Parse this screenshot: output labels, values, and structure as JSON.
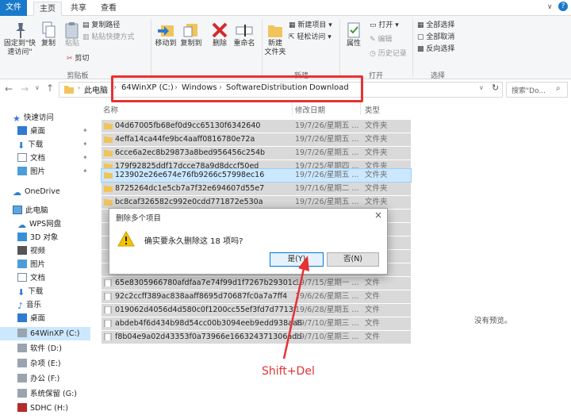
{
  "tabs": [
    "文件",
    "主页",
    "共享",
    "查看"
  ],
  "ribbon": {
    "pin": "固定到\"快\n速访问\"",
    "copy": "复制",
    "paste": "粘贴",
    "copy_path": "复制路径",
    "paste_shortcut": "粘贴快捷方式",
    "cut": "剪切",
    "move_to": "移动到",
    "copy_to": "复制到",
    "delete": "删除",
    "rename": "重命名",
    "new_folder": "新建\n文件夹",
    "new_item": "新建项目",
    "easy_access": "轻松访问",
    "properties": "属性",
    "open": "打开",
    "edit": "编辑",
    "history": "历史记录",
    "select_all": "全部选择",
    "select_none": "全部取消",
    "invert": "反向选择",
    "grp_clipboard": "剪贴板",
    "grp_new": "新建",
    "grp_open": "打开",
    "grp_select": "选择"
  },
  "address": {
    "crumbs": [
      "此电脑",
      "64WinXP  (C:)",
      "Windows",
      "SoftwareDistribution",
      "Download"
    ],
    "search_placeholder": "搜索\"Do..."
  },
  "nav": {
    "quick_access": "快速访问",
    "items": [
      "桌面",
      "下载",
      "文档",
      "图片"
    ],
    "onedrive": "OneDrive",
    "this_pc": "此电脑",
    "pc_items": [
      "WPS网盘",
      "3D 对象",
      "视频",
      "图片",
      "文档",
      "下载",
      "音乐",
      "桌面",
      "64WinXP  (C:)",
      "软件 (D:)",
      "杂项 (E:)",
      "办公 (F:)",
      "系统保留 (G:)",
      "SDHC (H:)"
    ]
  },
  "list": {
    "col_name": "名称",
    "col_date": "修改日期",
    "col_type": "类型",
    "rows": [
      {
        "name": "04d67005fb68ef0d9cc65130f6342640",
        "date": "19/7/26/星期五 ...",
        "type": "文件夹"
      },
      {
        "name": "4effa14ca44fe9bc4aaff0816780e72a",
        "date": "19/7/26/星期五 ...",
        "type": "文件夹"
      },
      {
        "name": "6cce6a2ec8b29873a8bed956456c254b",
        "date": "19/7/26/星期五 ...",
        "type": "文件夹"
      },
      {
        "name": "179f92825ddf17dcce78a9d8dccf50ed",
        "date": "19/7/25/星期四 ...",
        "type": "文件夹"
      },
      {
        "name": "123902e26e674e76fb9266c57998ec16",
        "date": "19/7/26/星期五 ...",
        "type": "文件夹"
      },
      {
        "name": "8725264dc1e5cb7a7f32e694607d55e7",
        "date": "19/7/16/星期二 ...",
        "type": "文件夹"
      },
      {
        "name": "bc8caf326582c992e0cdd771872e530a",
        "date": "19/7/26/星期五 ...",
        "type": "文件夹"
      },
      {
        "name": "65e8305966780afdfaa7e74f99d1f7267b29301c",
        "date": "19/7/15/星期一 ...",
        "type": "文件"
      },
      {
        "name": "92c2ccff389ac838aaff8695d70687fc0a7a7ff4",
        "date": "19/6/26/星期三 ...",
        "type": "文件"
      },
      {
        "name": "019062d4056d4d580c0f1200cc55ef3fd7d7713f",
        "date": "19/6/28/星期五 ...",
        "type": "文件"
      },
      {
        "name": "abdeb4f6d434b98d54cc00b3094eeb9edd938aa8",
        "date": "19/7/10/星期三 ...",
        "type": "文件"
      },
      {
        "name": "f8b04e9a02d43353f0a73966e166324371306add",
        "date": "19/7/10/星期三 ...",
        "type": "文件"
      }
    ],
    "no_preview": "没有预览。"
  },
  "dialog": {
    "title": "删除多个项目",
    "message": "确实要永久删除这 18 项吗?",
    "yes": "是(Y)",
    "no": "否(N)"
  },
  "annotation": "Shift+Del"
}
